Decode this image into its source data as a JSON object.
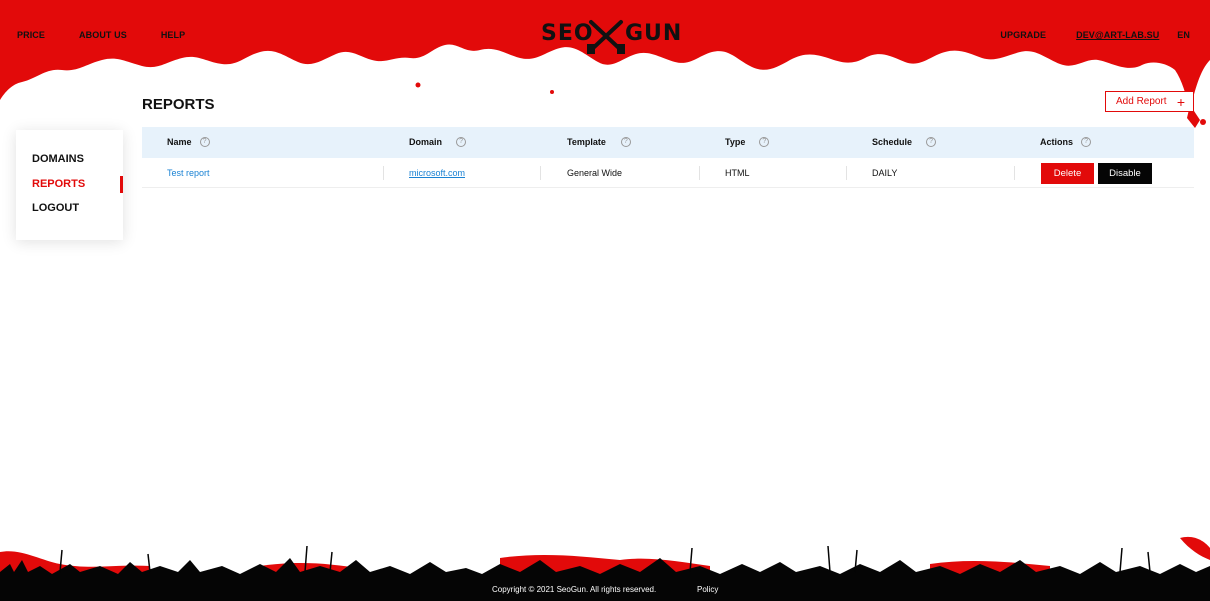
{
  "header": {
    "nav_left": [
      "PRICE",
      "ABOUT US",
      "HELP"
    ],
    "logo_text_left": "SEO",
    "logo_text_right": "GUN",
    "upgrade": "UPGRADE",
    "email": "DEV@ART-LAB.SU",
    "lang": "EN"
  },
  "sidebar": {
    "items": [
      {
        "label": "DOMAINS"
      },
      {
        "label": "REPORTS",
        "active": true
      },
      {
        "label": "LOGOUT"
      }
    ]
  },
  "page": {
    "title": "REPORTS",
    "add_report": "Add Report",
    "add_icon": "+"
  },
  "table": {
    "headers": [
      "Name",
      "Domain",
      "Template",
      "Type",
      "Schedule",
      "Actions"
    ],
    "help_glyph": "?",
    "rows": [
      {
        "name": "Test report",
        "domain": "microsoft.com",
        "template": "General Wide",
        "type": "HTML",
        "schedule": "DAILY",
        "delete": "Delete",
        "disable": "Disable"
      }
    ]
  },
  "footer": {
    "copyright": "Copyright © 2021 SeoGun. All rights reserved.",
    "policy": "Policy"
  },
  "colors": {
    "brand_red": "#e20a0a",
    "table_header_bg": "#e7f2fb",
    "link_blue": "#1a82d3"
  }
}
